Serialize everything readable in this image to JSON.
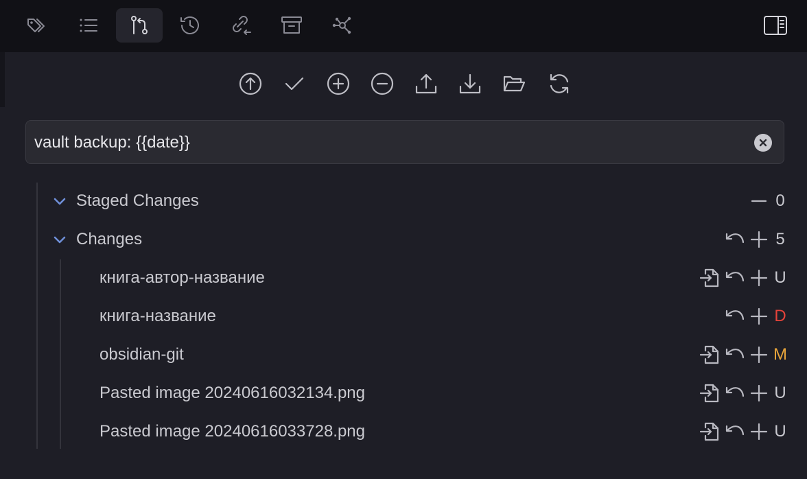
{
  "tabs": [
    {
      "icon": "tags-icon",
      "active": false
    },
    {
      "icon": "list-icon",
      "active": false
    },
    {
      "icon": "git-branch-icon",
      "active": true
    },
    {
      "icon": "history-icon",
      "active": false
    },
    {
      "icon": "link-arrow-icon",
      "active": false
    },
    {
      "icon": "archive-icon",
      "active": false
    },
    {
      "icon": "graph-icon",
      "active": false
    }
  ],
  "right_toggle_icon": "sidebar-toggle-icon",
  "toolbar": [
    "commit-and-sync-icon",
    "commit-icon",
    "stage-all-icon",
    "unstage-all-icon",
    "push-icon",
    "pull-icon",
    "folder-icon",
    "refresh-icon"
  ],
  "commit_message": {
    "value": "vault backup: {{date}}"
  },
  "staged": {
    "label": "Staged Changes",
    "count": "0"
  },
  "changes": {
    "label": "Changes",
    "count": "5",
    "files": [
      {
        "name": "книга-автор-название",
        "status": "U",
        "status_color": "#c9c9cf",
        "has_open": true
      },
      {
        "name": "книга-название",
        "status": "D",
        "status_color": "#e5433a",
        "has_open": false
      },
      {
        "name": "obsidian-git",
        "status": "M",
        "status_color": "#e8a53b",
        "has_open": true
      },
      {
        "name": "Pasted image 20240616032134.png",
        "status": "U",
        "status_color": "#c9c9cf",
        "has_open": true
      },
      {
        "name": "Pasted image 20240616033728.png",
        "status": "U",
        "status_color": "#c9c9cf",
        "has_open": true
      }
    ]
  },
  "colors": {
    "accent_chevron": "#6f8fd8",
    "background": "#1e1e26",
    "topbar": "#111116"
  }
}
